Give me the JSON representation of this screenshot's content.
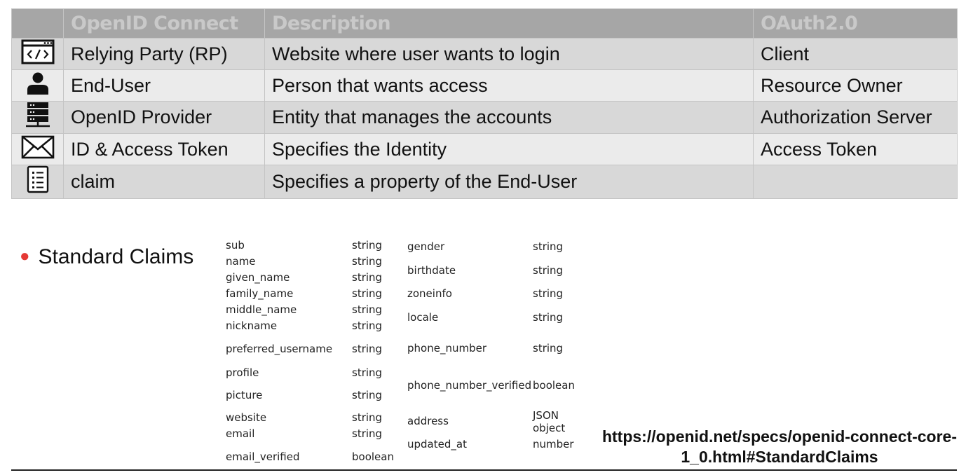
{
  "mapping_table": {
    "headers": [
      "OpenID Connect",
      "Description",
      "OAuth2.0"
    ],
    "rows": [
      {
        "icon": "browser-code-icon",
        "term": "Relying Party (RP)",
        "description": "Website where user wants to login",
        "oauth": "Client"
      },
      {
        "icon": "user-icon",
        "term": "End-User",
        "description": "Person that wants access",
        "oauth": "Resource Owner"
      },
      {
        "icon": "server-icon",
        "term": "OpenID Provider",
        "description": "Entity that manages the accounts",
        "oauth": "Authorization Server"
      },
      {
        "icon": "envelope-icon",
        "term": "ID & Access Token",
        "description": "Specifies the Identity",
        "oauth": "Access Token"
      },
      {
        "icon": "list-document-icon",
        "term": "claim",
        "description": "Specifies a property of the End-User",
        "oauth": ""
      }
    ]
  },
  "standard_claims": {
    "heading": "Standard Claims",
    "left_column": [
      {
        "name": "sub",
        "type": "string"
      },
      {
        "name": "name",
        "type": "string"
      },
      {
        "name": "given_name",
        "type": "string"
      },
      {
        "name": "family_name",
        "type": "string"
      },
      {
        "name": "middle_name",
        "type": "string"
      },
      {
        "name": "nickname",
        "type": "string"
      },
      {
        "name": "preferred_username",
        "type": "string"
      },
      {
        "name": "profile",
        "type": "string"
      },
      {
        "name": "picture",
        "type": "string"
      },
      {
        "name": "website",
        "type": "string"
      },
      {
        "name": "email",
        "type": "string"
      },
      {
        "name": "email_verified",
        "type": "boolean"
      }
    ],
    "right_column": [
      {
        "name": "gender",
        "type": "string"
      },
      {
        "name": "birthdate",
        "type": "string"
      },
      {
        "name": "zoneinfo",
        "type": "string"
      },
      {
        "name": "locale",
        "type": "string"
      },
      {
        "name": "phone_number",
        "type": "string"
      },
      {
        "name": "phone_number_verified",
        "type": "boolean"
      },
      {
        "name": "address",
        "type": "JSON object"
      },
      {
        "name": "updated_at",
        "type": "number"
      }
    ]
  },
  "spec_link": {
    "line1": "https://openid.net/specs/openid-connect-core-",
    "line2": "1_0.html#StandardClaims"
  }
}
